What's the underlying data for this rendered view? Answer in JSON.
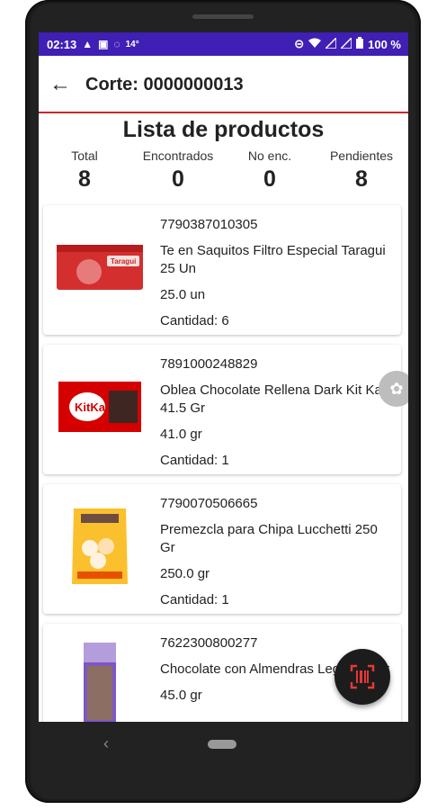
{
  "status_bar": {
    "time": "02:13",
    "temperature": "14°",
    "battery": "100 %",
    "icons_left": [
      "warning-icon",
      "app-icon",
      "signal-alt-icon"
    ],
    "icons_right": [
      "do-not-disturb-icon",
      "wifi-icon",
      "cell-signal-icon",
      "battery-icon"
    ]
  },
  "app_bar": {
    "title": "Corte: 0000000013",
    "back_icon": "arrow-left-icon"
  },
  "accent_color": "#c62828",
  "status_bar_color": "#3f1fb4",
  "list": {
    "title": "Lista de productos",
    "stats": [
      {
        "label": "Total",
        "value": "8"
      },
      {
        "label": "Encontrados",
        "value": "0"
      },
      {
        "label": "No enc.",
        "value": "0"
      },
      {
        "label": "Pendientes",
        "value": "8"
      }
    ],
    "products": [
      {
        "code": "7790387010305",
        "name": "Te en Saquitos Filtro Especial Taragui 25 Un",
        "qty_unit": "25.0 un",
        "quantity": "Cantidad: 6",
        "image": "tea-box"
      },
      {
        "code": "7891000248829",
        "name": "Oblea Chocolate Rellena Dark Kit Kat 41.5 Gr",
        "qty_unit": "41.0 gr",
        "quantity": "Cantidad: 1",
        "image": "kitkat-bar"
      },
      {
        "code": "7790070506665",
        "name": "Premezcla para Chipa Lucchetti 250 Gr",
        "qty_unit": "250.0 gr",
        "quantity": "Cantidad: 1",
        "image": "chipa-bag"
      },
      {
        "code": "7622300800277",
        "name": "Chocolate con Almendras Leger 45 Gr",
        "qty_unit": "45.0 gr",
        "quantity": "",
        "image": "milka-bar"
      }
    ]
  },
  "fab": {
    "icon": "barcode-scan-icon"
  },
  "nav": {
    "back_icon": "nav-back-icon",
    "home_icon": "nav-home-icon"
  }
}
